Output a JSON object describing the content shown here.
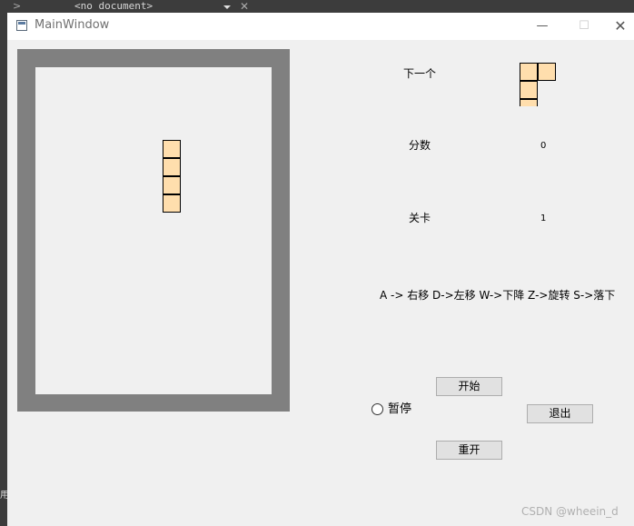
{
  "background_editor": {
    "tab_arrow": ">",
    "document_label": "<no document>",
    "close_glyph": "✕",
    "side_text": "用 Te"
  },
  "window": {
    "title": "MainWindow",
    "minimize_glyph": "—",
    "maximize_glyph": "☐",
    "close_glyph": "✕"
  },
  "board": {
    "falling_piece": "I",
    "block_color": "#ffdead"
  },
  "side_panel": {
    "next_label": "下一个",
    "next_piece": "J",
    "score_label": "分数",
    "score_value": "0",
    "level_label": "关卡",
    "level_value": "1",
    "controls": "A -> 右移 D->左移 W->下降 Z->旋转 S->落下"
  },
  "buttons": {
    "start": "开始",
    "exit": "退出",
    "restart": "重开"
  },
  "pause": {
    "label": "暂停",
    "checked": false
  },
  "watermark": "CSDN @wheein_d"
}
